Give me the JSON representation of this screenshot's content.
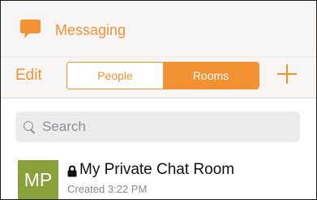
{
  "header": {
    "title": "Messaging",
    "icon": "chat-bubble-icon",
    "accent": "#f39233"
  },
  "toolbar": {
    "edit_label": "Edit",
    "segments": [
      {
        "label": "People",
        "selected": false
      },
      {
        "label": "Rooms",
        "selected": true
      }
    ],
    "add_icon": "plus-icon"
  },
  "search": {
    "placeholder": "Search",
    "icon": "search-icon"
  },
  "rooms": [
    {
      "initials": "MP",
      "avatar_color": "#8aa13b",
      "icon": "lock-icon",
      "title": "My Private Chat Room",
      "subtitle": "Created 3:22 PM"
    }
  ]
}
